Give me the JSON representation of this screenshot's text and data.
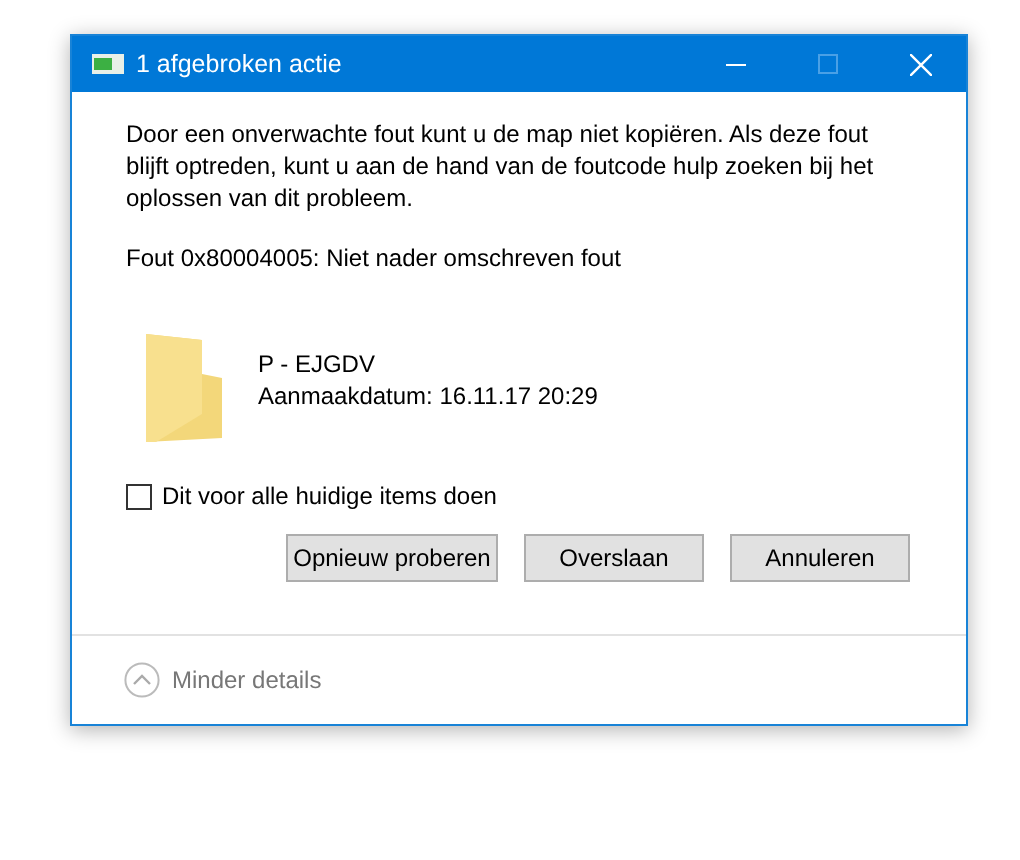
{
  "window": {
    "title": "1 afgebroken actie"
  },
  "message": "Door een onverwachte fout kunt u de map niet kopiëren. Als deze fout blijft optreden, kunt u aan de hand van de foutcode hulp zoeken bij het oplossen van dit probleem.",
  "error": "Fout 0x80004005: Niet nader omschreven fout",
  "item": {
    "name": "P - EJGDV",
    "created": "Aanmaakdatum: 16.11.17 20:29"
  },
  "checkbox": {
    "label": "Dit voor alle huidige items doen",
    "checked": false
  },
  "buttons": [
    "Opnieuw proberen",
    "Overslaan",
    "Annuleren"
  ],
  "details_toggle": {
    "label": "Minder details",
    "expanded": true
  }
}
